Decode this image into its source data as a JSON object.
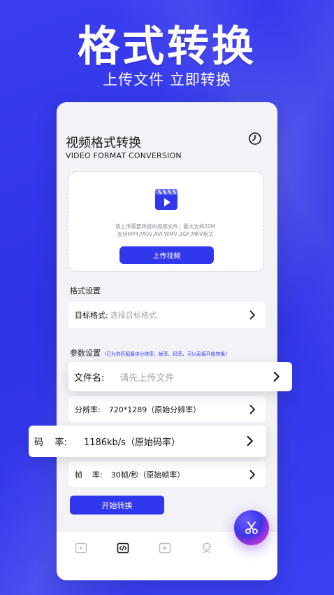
{
  "hero": {
    "title": "格式转换",
    "subtitle": "上传文件 立即转换"
  },
  "app": {
    "title": "视频格式转换",
    "subtitle": "VIDEO FORMAT CONVERSION",
    "history_icon": "clock-icon"
  },
  "upload": {
    "icon": "video-file-icon",
    "hint_line1": "请上传需要转换的视频文件，最大支持20M",
    "hint_line2": "支持MP4,MOV,AVI,WMV,3GP,MKV格式",
    "button_label": "上传视频"
  },
  "format_settings": {
    "section_label": "格式设置",
    "target_label": "目标格式:",
    "target_placeholder": "选择目标格式"
  },
  "params": {
    "section_label": "参数设置",
    "section_note": "(已为你匹配最佳分辨率、帧率、码率，可以直接开始转换)",
    "filename_label": "文件名:",
    "filename_placeholder": "请先上传文件",
    "resolution_label": "分辨率:",
    "resolution_value": "720*1289（原始分辨率）",
    "bitrate_label": "码    率:",
    "bitrate_value": "1186kb/s（原始码率）",
    "framerate_label": "帧    率:",
    "framerate_value": "30帧/秒（原始帧率）"
  },
  "actions": {
    "start_label": "开始转换",
    "fab_icon": "scissors-icon"
  },
  "tabbar": {
    "tabs": [
      "video-play-icon",
      "code-icon",
      "media-play-icon",
      "profile-icon"
    ],
    "active_index": 1
  },
  "colors": {
    "background": "#3137ec",
    "accent": "#3137ec",
    "card": "#f2f2f7"
  }
}
